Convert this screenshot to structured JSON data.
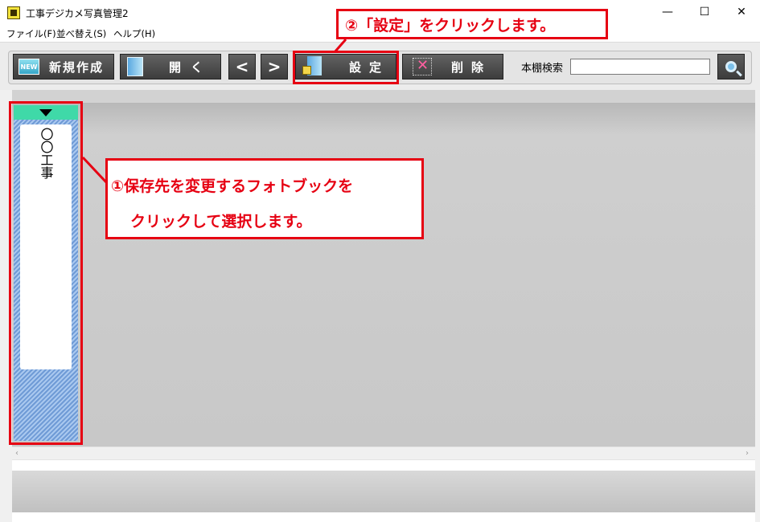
{
  "window": {
    "title": "工事デジカメ写真管理2",
    "minimize": "—",
    "maximize": "☐",
    "close": "✕"
  },
  "menu": {
    "items": [
      "ファイル(F)",
      "並べ替え(S)",
      "ヘルプ(H)"
    ]
  },
  "toolbar": {
    "new_label": "新規作成",
    "new_badge": "NEW",
    "open_label": "開く",
    "prev_label": "<",
    "next_label": ">",
    "settings_label": "設定",
    "delete_label": "削除",
    "search_label": "本棚検索",
    "search_value": ""
  },
  "shelf": {
    "books": [
      {
        "title": "〇〇工事"
      }
    ]
  },
  "annotations": {
    "step2": "②「設定」をクリックします。",
    "step1_line1": "①保存先を変更するフォトブックを",
    "step1_line2": "クリックして選択します。"
  },
  "colors": {
    "annotation": "#e60012",
    "shelf_top": "#3fd9a8",
    "shelf_stripe": "#6f9bd6",
    "button": "#4a4a4a"
  },
  "icons": {
    "new": "new-badge-icon",
    "open": "book-icon",
    "settings": "lock-book-icon",
    "delete": "delete-x-icon",
    "search": "magnifier-icon"
  }
}
